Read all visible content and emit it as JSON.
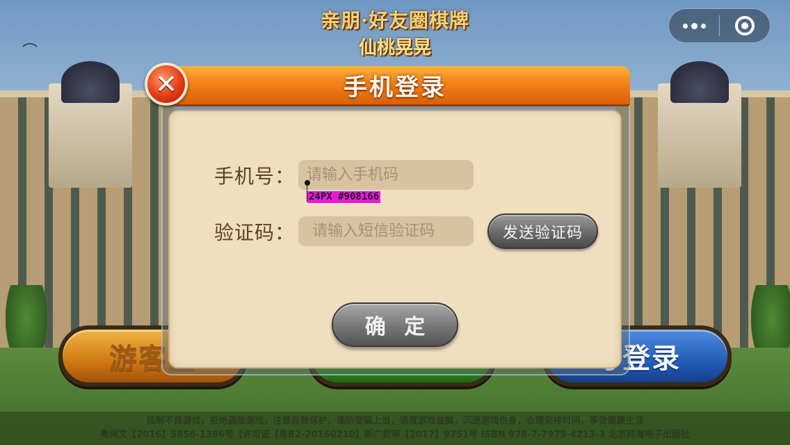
{
  "logo": {
    "line1": "亲朋·好友圈棋牌",
    "line2": "仙桃晃晃"
  },
  "capsule": {
    "more_icon": "more-dots-icon",
    "close_icon": "target-close-icon"
  },
  "main_buttons": {
    "guest": "游客登",
    "account": "号登录"
  },
  "modal": {
    "title": "手机登录",
    "close_icon": "close-x-icon",
    "close_glyph": "✕",
    "phone_label": "手机号：",
    "phone_placeholder": "请输入手机码",
    "code_label": "验证码：",
    "code_placeholder": "请输入短信验证码",
    "send_code_label": "发送验证码",
    "confirm_label": "确 定"
  },
  "annotation": {
    "text": "24PX #908166"
  },
  "footer": {
    "line1": "抵制不良游戏，拒绝盗版游戏，注意自我保护，谨防受骗上当，适度游戏益脑，沉迷游戏伤身，合理安排时间，享受健康生活",
    "line2": "粤网文【2016】5856-1386号【许可证【粤B2-20160210】新广初审【2017】9751号 ISBN 978-7-7979-4213-3 北京科海电子出版社"
  },
  "colors": {
    "header_orange": "#f2821a",
    "body_beige": "#efdfbf",
    "input_bg": "#d8c3a0",
    "placeholder_text": "#908166",
    "annotation_magenta": "#e81ad6"
  }
}
